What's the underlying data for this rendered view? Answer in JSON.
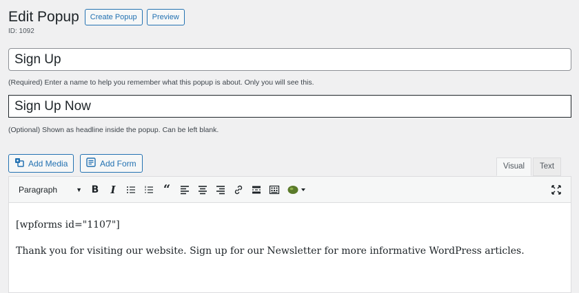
{
  "header": {
    "title": "Edit Popup",
    "create_label": "Create Popup",
    "preview_label": "Preview",
    "id_text": "ID: 1092"
  },
  "fields": {
    "name_value": "Sign Up",
    "name_help": "(Required) Enter a name to help you remember what this popup is about. Only you will see this.",
    "headline_value": "Sign Up Now",
    "headline_help": "(Optional) Shown as headline inside the popup. Can be left blank."
  },
  "editor": {
    "add_media_label": "Add Media",
    "add_form_label": "Add Form",
    "tab_visual": "Visual",
    "tab_text": "Text",
    "format_value": "Paragraph",
    "toolbar_icons": [
      "bold-icon",
      "italic-icon",
      "bullet-list-icon",
      "numbered-list-icon",
      "blockquote-icon",
      "align-left-icon",
      "align-center-icon",
      "align-right-icon",
      "link-icon",
      "read-more-icon",
      "toolbar-toggle-icon",
      "mailchimp-icon",
      "fullscreen-icon"
    ],
    "content_lines": [
      "[wpforms id=\"1107\"]",
      "Thank you for visiting our website. Sign up for our Newsletter for more informative WordPress articles."
    ]
  },
  "colors": {
    "accent": "#2271b1",
    "background": "#f0f0f1",
    "text": "#1d2327"
  }
}
